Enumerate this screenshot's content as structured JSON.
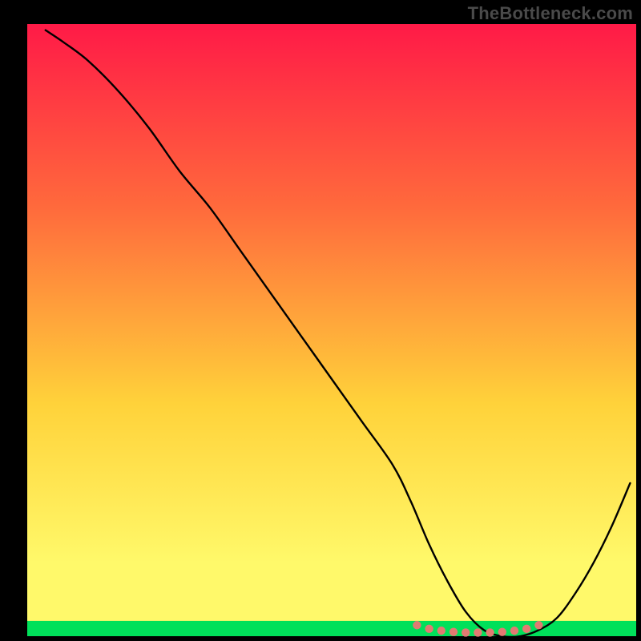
{
  "watermark": "TheBottleneck.com",
  "colors": {
    "top_gradient": "#ff1a47",
    "mid1": "#ff6a3c",
    "mid2": "#ffd23a",
    "mid3": "#fff96a",
    "bottom_band": "#00e05a",
    "curve": "#000000",
    "dots": "#e27a72",
    "frame": "#000000"
  },
  "chart_data": {
    "type": "line",
    "title": "",
    "xlabel": "",
    "ylabel": "",
    "xlim": [
      0,
      100
    ],
    "ylim": [
      0,
      100
    ],
    "series": [
      {
        "name": "curve",
        "x": [
          3,
          6,
          10,
          15,
          20,
          25,
          30,
          35,
          40,
          45,
          50,
          55,
          60,
          63,
          66,
          69,
          72,
          75,
          78,
          81,
          84,
          87,
          90,
          93,
          96,
          99
        ],
        "y": [
          99,
          97,
          94,
          89,
          83,
          76,
          70,
          63,
          56,
          49,
          42,
          35,
          28,
          22,
          15,
          9,
          4,
          1,
          0,
          0,
          1,
          3,
          7,
          12,
          18,
          25
        ]
      }
    ],
    "dots": {
      "name": "highlight-dots",
      "x": [
        64,
        66,
        68,
        70,
        72,
        74,
        76,
        78,
        80,
        82,
        84
      ],
      "y": [
        1.8,
        1.2,
        0.9,
        0.7,
        0.6,
        0.6,
        0.6,
        0.7,
        0.9,
        1.2,
        1.8
      ]
    },
    "green_band_fraction": 0.025
  }
}
